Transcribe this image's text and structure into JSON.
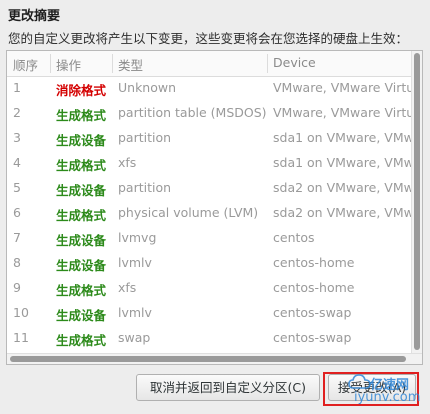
{
  "header": {
    "title": "更改摘要",
    "description": "您的自定义更改将产生以下变更，这些变更将会在您选择的硬盘上生效："
  },
  "table": {
    "columns": [
      "顺序",
      "操作",
      "类型",
      "Device"
    ],
    "rows": [
      {
        "order": "1",
        "action": "消除格式",
        "type": "Unknown",
        "device": "VMware, VMware Virtu",
        "action_color": "red"
      },
      {
        "order": "2",
        "action": "生成格式",
        "type": "partition table (MSDOS)",
        "device": "VMware, VMware Virtu",
        "action_color": "green"
      },
      {
        "order": "3",
        "action": "生成设备",
        "type": "partition",
        "device": "sda1 on VMware, VMw",
        "action_color": "green"
      },
      {
        "order": "4",
        "action": "生成格式",
        "type": "xfs",
        "device": "sda1 on VMware, VMw",
        "action_color": "green"
      },
      {
        "order": "5",
        "action": "生成设备",
        "type": "partition",
        "device": "sda2 on VMware, VMw",
        "action_color": "green"
      },
      {
        "order": "6",
        "action": "生成格式",
        "type": "physical volume (LVM)",
        "device": "sda2 on VMware, VMw",
        "action_color": "green"
      },
      {
        "order": "7",
        "action": "生成设备",
        "type": "lvmvg",
        "device": "centos",
        "action_color": "green"
      },
      {
        "order": "8",
        "action": "生成设备",
        "type": "lvmlv",
        "device": "centos-home",
        "action_color": "green"
      },
      {
        "order": "9",
        "action": "生成格式",
        "type": "xfs",
        "device": "centos-home",
        "action_color": "green"
      },
      {
        "order": "10",
        "action": "生成设备",
        "type": "lvmlv",
        "device": "centos-swap",
        "action_color": "green"
      },
      {
        "order": "11",
        "action": "生成格式",
        "type": "swap",
        "device": "centos-swap",
        "action_color": "green"
      }
    ]
  },
  "buttons": {
    "cancel_label": "取消并返回到自定义分区(C)",
    "accept_label": "接受更改(A)"
  },
  "watermark": {
    "line1": "亿速网",
    "line2": "iyunv.com"
  },
  "colors": {
    "action_red": "#d40000",
    "action_green": "#2c8a1a",
    "highlight_border": "#e02020"
  }
}
